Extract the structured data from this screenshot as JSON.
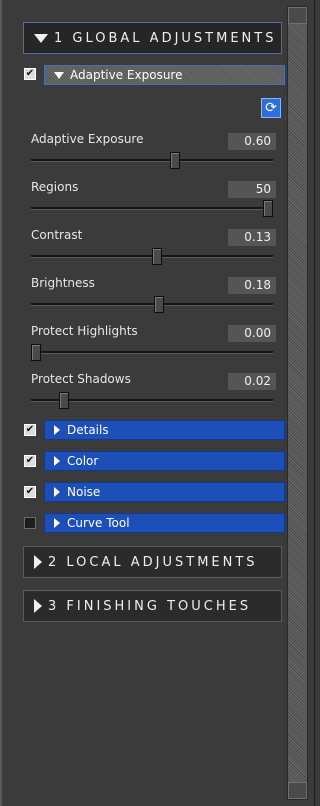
{
  "sections": {
    "global": {
      "label": "1 GLOBAL ADJUSTMENTS"
    },
    "local": {
      "label": "2 LOCAL ADJUSTMENTS"
    },
    "finishing": {
      "label": "3 FINISHING TOUCHES"
    }
  },
  "adaptive_exposure": {
    "label": "Adaptive Exposure",
    "checked": true,
    "reset_icon": "refresh-icon"
  },
  "sliders": [
    {
      "label": "Adaptive Exposure",
      "value": "0.60",
      "level": 0.6
    },
    {
      "label": "Regions",
      "value": "50",
      "level": 1.0
    },
    {
      "label": "Contrast",
      "value": "0.13",
      "level": 0.52
    },
    {
      "label": "Brightness",
      "value": "0.18",
      "level": 0.53
    },
    {
      "label": "Protect Highlights",
      "value": "0.00",
      "level": 0.0
    },
    {
      "label": "Protect Shadows",
      "value": "0.02",
      "level": 0.12
    }
  ],
  "subsections": [
    {
      "label": "Details",
      "checked": true
    },
    {
      "label": "Color",
      "checked": true
    },
    {
      "label": "Noise",
      "checked": true
    },
    {
      "label": "Curve Tool",
      "checked": false
    }
  ],
  "colors": {
    "accent_blue": "#1d4fb8",
    "panel_bg": "#3b3b3b"
  }
}
